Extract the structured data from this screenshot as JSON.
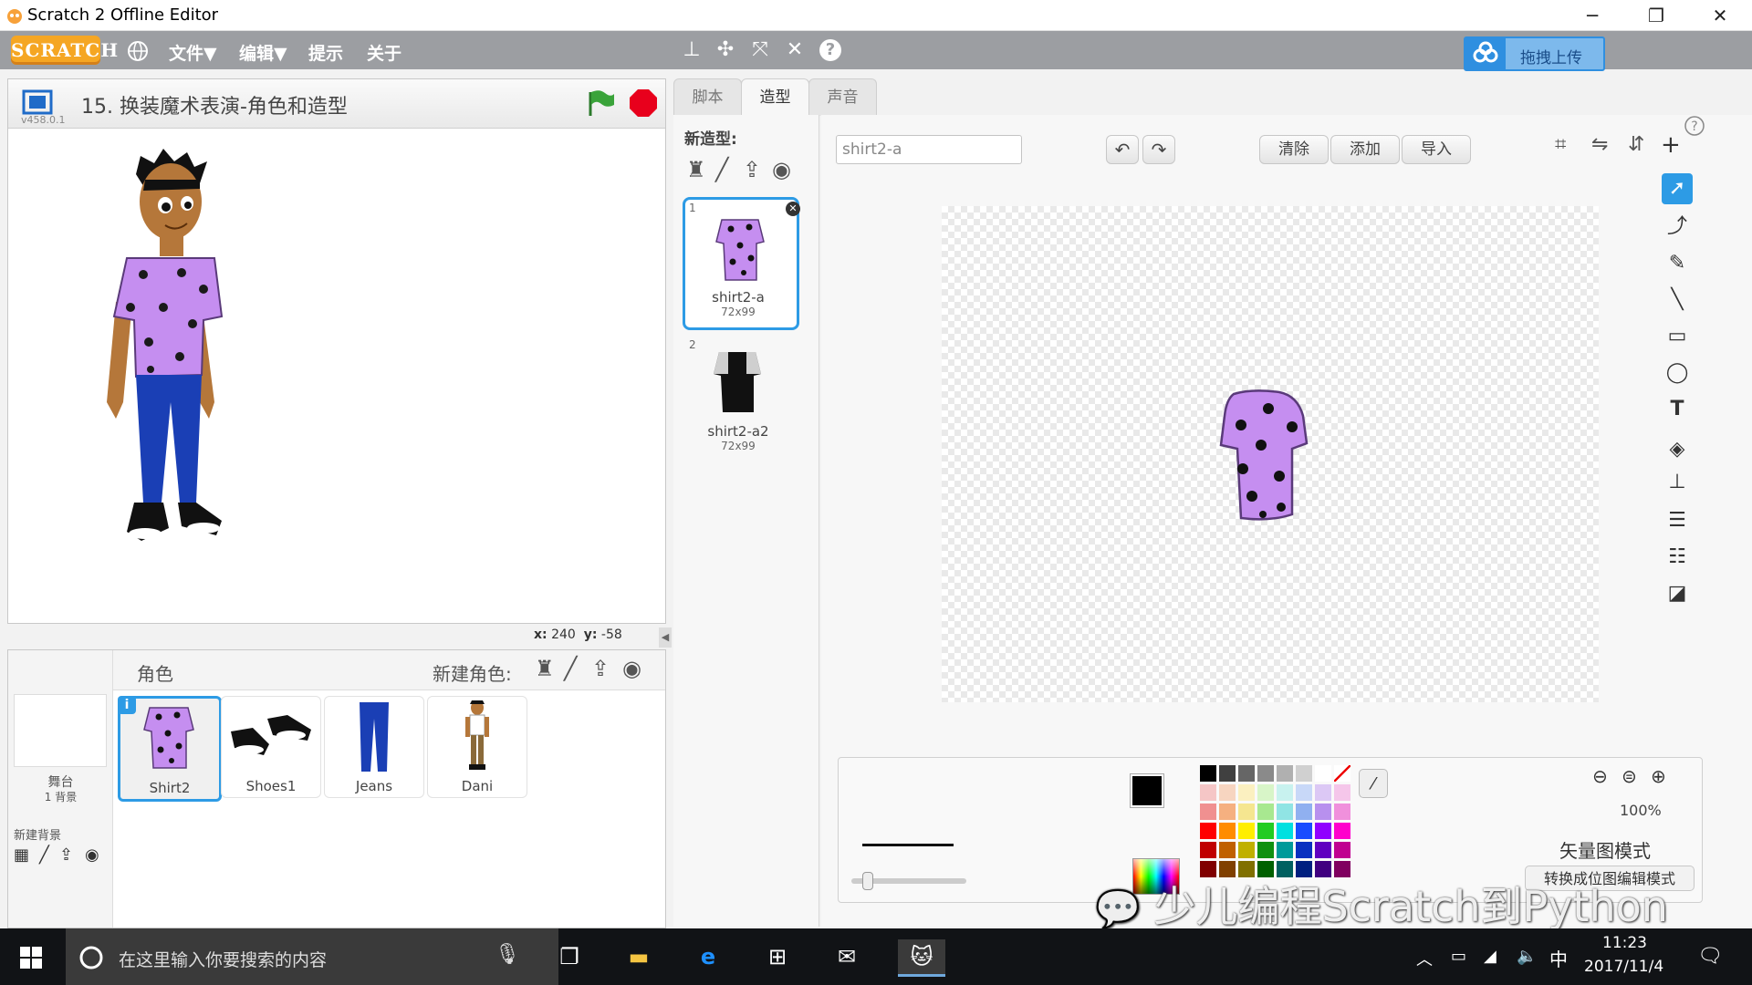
{
  "window": {
    "title": "Scratch 2 Offline Editor",
    "min": "─",
    "max": "❐",
    "close": "✕"
  },
  "menubar": {
    "logo": "SCRATCH",
    "file": "文件▼",
    "edit": "编辑▼",
    "tips": "提示",
    "about": "关于",
    "upload": "拖拽上传",
    "help": "?"
  },
  "stage": {
    "version": "v458.0.1",
    "project_title": "15. 换装魔术表演-角色和造型",
    "coords_x_label": "x:",
    "coords_x": "240",
    "coords_y_label": "y:",
    "coords_y": "-58"
  },
  "sprites": {
    "header": "角色",
    "new_sprite_label": "新建角色:",
    "stage_label": "舞台",
    "stage_backdrops": "1 背景",
    "new_backdrop_label": "新建背景",
    "items": [
      {
        "name": "Shirt2"
      },
      {
        "name": "Shoes1"
      },
      {
        "name": "Jeans"
      },
      {
        "name": "Dani"
      }
    ]
  },
  "tabs": {
    "scripts": "脚本",
    "costumes": "造型",
    "sounds": "声音"
  },
  "costumes": {
    "new_costume_label": "新造型:",
    "items": [
      {
        "index": "1",
        "name": "shirt2-a",
        "size": "72x99"
      },
      {
        "index": "2",
        "name": "shirt2-a2",
        "size": "72x99"
      }
    ]
  },
  "editor": {
    "costume_name_value": "shirt2-a",
    "clear": "清除",
    "add": "添加",
    "import": "导入",
    "zoom": "100%",
    "mode_label": "矢量图模式",
    "convert_button": "转换成位图编辑模式"
  },
  "palette": {
    "rows": [
      [
        "#000000",
        "#404040",
        "#666666",
        "#8a8a8a",
        "#b0b0b0",
        "#d0d0d0",
        "#ffffff",
        "none"
      ],
      [
        "#f5c6c6",
        "#f7d5c0",
        "#fbf0c0",
        "#d8f5c8",
        "#c8f2ef",
        "#c8d8f8",
        "#dcc8f5",
        "#f5c6ea"
      ],
      [
        "#f09090",
        "#f5b080",
        "#f5e690",
        "#a8e890",
        "#90e4e4",
        "#90b0f0",
        "#b890ee",
        "#f090dc"
      ],
      [
        "#ff0000",
        "#ff8c00",
        "#ffee00",
        "#22cc22",
        "#00e0e0",
        "#1a4cff",
        "#9000ff",
        "#ff00cc"
      ],
      [
        "#c00000",
        "#c06000",
        "#c0b000",
        "#109010",
        "#009a9a",
        "#0a30c0",
        "#6000c0",
        "#c00090"
      ],
      [
        "#800000",
        "#804000",
        "#807000",
        "#006000",
        "#006060",
        "#002080",
        "#400080",
        "#800060"
      ]
    ]
  },
  "taskbar": {
    "search_placeholder": "在这里输入你要搜索的内容",
    "time": "11:23",
    "date": "2017/11/4",
    "ime": "中"
  },
  "watermark": "少儿编程Scratch到Python"
}
